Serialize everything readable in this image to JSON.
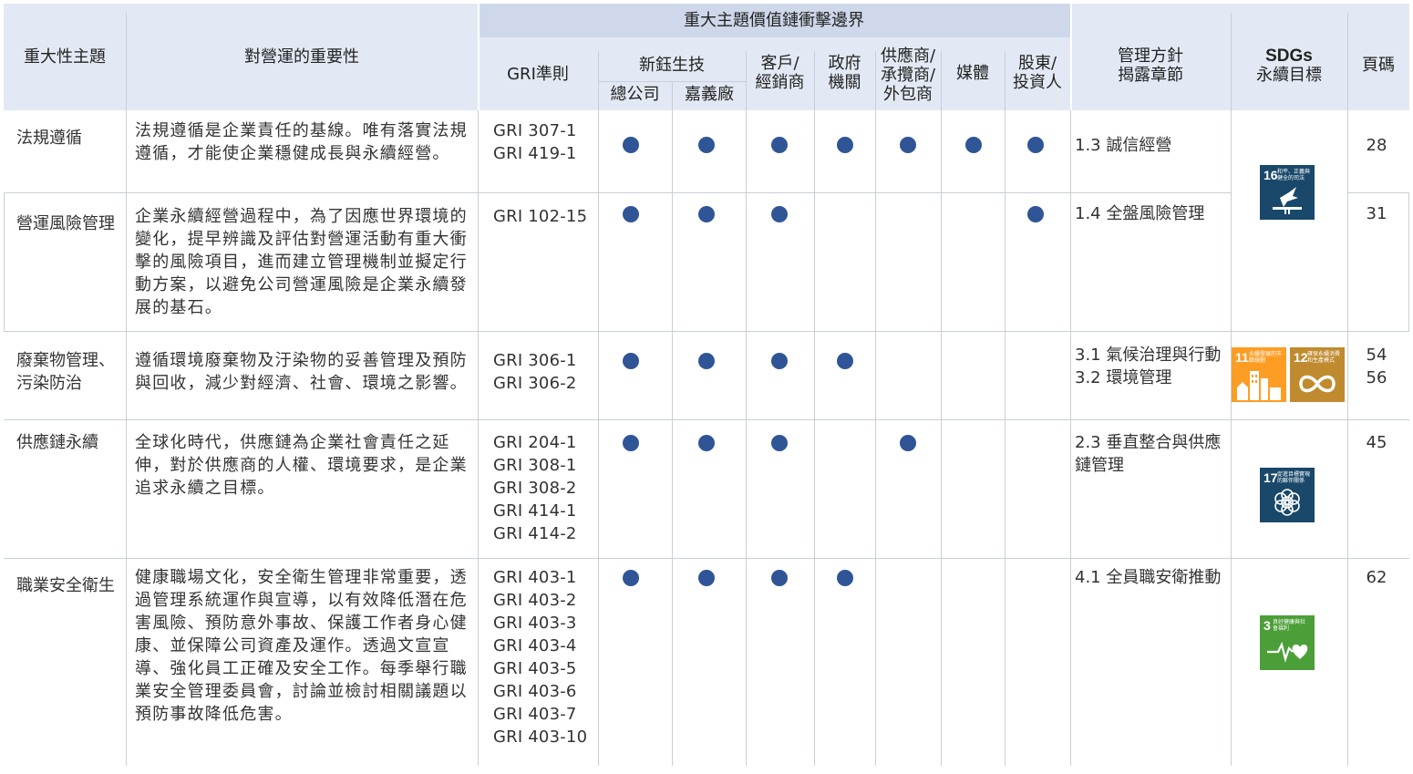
{
  "headers": {
    "topic": "重大性主題",
    "importance": "對營運的重要性",
    "boundary": "重大主題價值鏈衝擊邊界",
    "gri": "GRI準則",
    "company": "新鈺生技",
    "hq": "總公司",
    "chiayi": "嘉義廠",
    "customer": "客戶/\n經銷商",
    "government": "政府\n機關",
    "supplier": "供應商/\n承攬商/\n外包商",
    "media": "媒體",
    "shareholder": "股東/\n投資人",
    "management": "管理方針\n揭露章節",
    "sdgs_title": "SDGs",
    "sdgs_sub": "永續目標",
    "page": "頁碼"
  },
  "rows": [
    {
      "topic": "法規遵循",
      "importance": "法規遵循是企業責任的基線。唯有落實法規遵循，才能使企業穩健成長與永續經營。",
      "gri": "GRI 307-1\nGRI 419-1",
      "impact": [
        true,
        true,
        true,
        true,
        true,
        true,
        true
      ],
      "management": "1.3 誠信經營",
      "page": "28"
    },
    {
      "topic": "營運風險管理",
      "importance": "企業永續經營過程中，為了因應世界環境的變化，提早辨識及評估對營運活動有重大衝擊的風險項目，進而建立管理機制並擬定行動方案，以避免公司營運風險是企業永續發展的基石。",
      "gri": "GRI 102-15",
      "impact": [
        true,
        true,
        true,
        false,
        false,
        false,
        true
      ],
      "management": "1.4 全盤風險管理",
      "page": "31"
    },
    {
      "topic": "廢棄物管理、污染防治",
      "importance": "遵循環境廢棄物及汙染物的妥善管理及預防與回收，減少對經濟、社會、環境之影響。",
      "gri": "GRI 306-1\nGRI 306-2",
      "impact": [
        true,
        true,
        true,
        true,
        false,
        false,
        false
      ],
      "management": "3.1 氣候治理與行動\n3.2 環境管理",
      "page": "54\n56"
    },
    {
      "topic": "供應鏈永續",
      "importance": "全球化時代，供應鏈為企業社會責任之延伸，對於供應商的人權、環境要求，是企業追求永續之目標。",
      "gri": "GRI 204-1\nGRI 308-1\nGRI 308-2\nGRI 414-1\nGRI 414-2",
      "impact": [
        true,
        true,
        true,
        false,
        true,
        false,
        false
      ],
      "management": "2.3 垂直整合與供應鏈管理",
      "page": "45"
    },
    {
      "topic": "職業安全衛生",
      "importance": "健康職場文化，安全衛生管理非常重要，透過管理系統運作與宣導，以有效降低潛在危害風險、預防意外事故、保護工作者身心健康、並保障公司資產及運作。透過文宣宣導、強化員工正確及安全工作。每季舉行職業安全管理委員會，討論並檢討相關議題以預防事故降低危害。",
      "gri": "GRI 403-1\nGRI 403-2\nGRI 403-3\nGRI 403-4\nGRI 403-5\nGRI 403-6\nGRI 403-7\nGRI 403-10",
      "impact": [
        true,
        true,
        true,
        true,
        false,
        false,
        false
      ],
      "management": "4.1 全員職安衛推動",
      "page": "62"
    }
  ],
  "sdgs": [
    {
      "number": "16",
      "label": "和平、正義與健全的司法",
      "icon": "dove-icon",
      "color": "#19486a"
    },
    {
      "number": "11",
      "label": "永續發展的市鎮規劃",
      "icon": "city-icon",
      "color": "#fd9d24"
    },
    {
      "number": "12",
      "label": "確保永續消費和生產模式",
      "icon": "infinity-icon",
      "color": "#bf8b2e"
    },
    {
      "number": "17",
      "label": "促進目標實現的夥伴關係",
      "icon": "flower-icon",
      "color": "#19486a"
    },
    {
      "number": "3",
      "label": "良好健康與社會福利",
      "icon": "heartbeat-icon",
      "color": "#4c9f38"
    }
  ],
  "colors": {
    "header_bg": "#e3e9f4",
    "header_band": "#cfd8ea",
    "dot": "#2f5597",
    "grid": "#c9cfd8"
  }
}
